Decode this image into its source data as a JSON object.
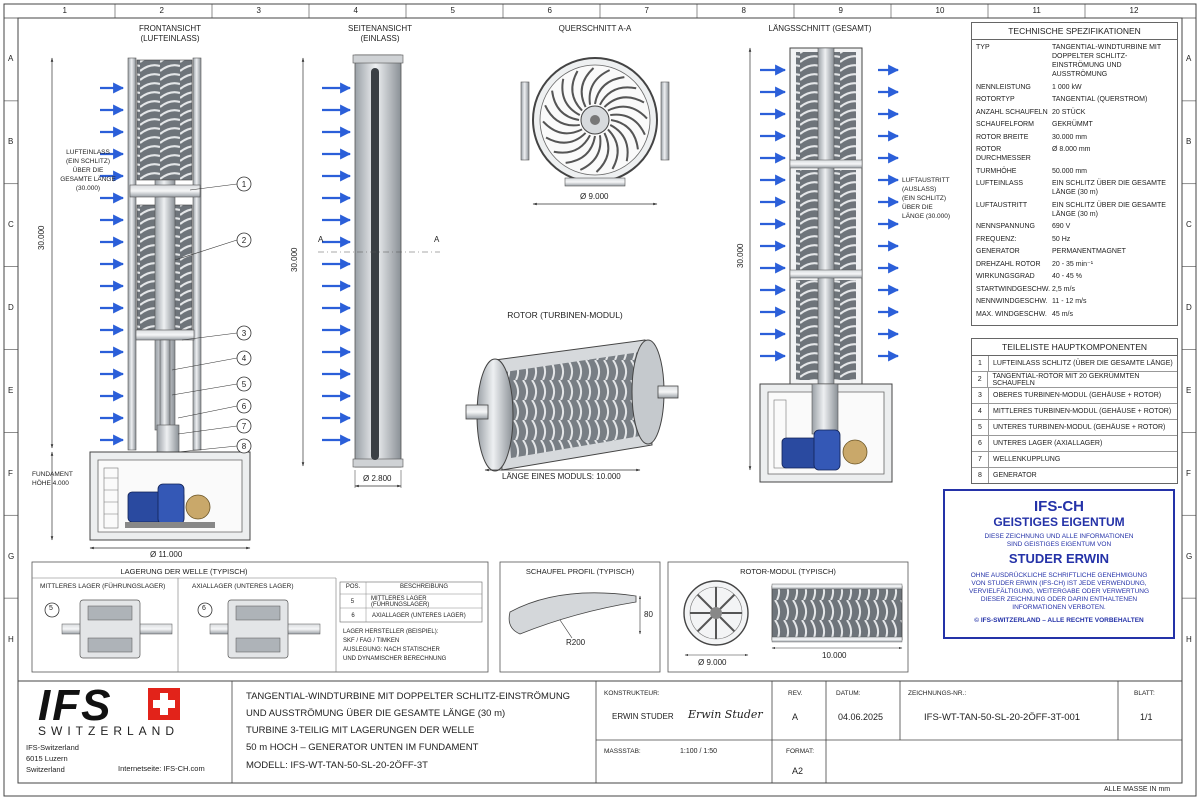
{
  "grid": {
    "cols": [
      "1",
      "2",
      "3",
      "4",
      "5",
      "6",
      "7",
      "8",
      "9",
      "10",
      "11",
      "12"
    ],
    "rows": [
      "A",
      "B",
      "C",
      "D",
      "E",
      "F",
      "G",
      "H"
    ]
  },
  "views": {
    "front_title": "FRONTANSICHT",
    "front_sub": "(LUFTEINLASS)",
    "side_title": "SEITENANSICHT",
    "side_sub": "(EINLASS)",
    "cross_title": "QUERSCHNITT A-A",
    "long_title": "LÄNGSSCHNITT (GESAMT)",
    "rotor_title": "ROTOR (TURBINEN-MODUL)"
  },
  "front": {
    "inlet_note": [
      "LUFTEINLASS",
      "(EIN SCHLITZ)",
      "ÜBER DIE",
      "GESAMTE LÄNGE",
      "(30.000)"
    ],
    "height_dim": "30.000",
    "foundation_note": [
      "FUNDAMENT",
      "HÖHE 4.000"
    ],
    "base_dim": "Ø 11.000",
    "balloons": [
      "1",
      "2",
      "3",
      "4",
      "5",
      "6",
      "7",
      "8"
    ]
  },
  "side": {
    "height_dim": "30.000",
    "section_mark": "A",
    "dia_dim": "Ø 2.800"
  },
  "cross": {
    "dia_dim": "Ø 9.000"
  },
  "longitudinal": {
    "height_dim": "30.000",
    "outlet_note": [
      "LUFTAUSTRITT",
      "(AUSLASS)",
      "(EIN SCHLITZ)",
      "ÜBER DIE",
      "LÄNGE (30.000)"
    ]
  },
  "rotor": {
    "length_dim": "LÄNGE EINES MODULS: 10.000"
  },
  "specs": {
    "title": "TECHNISCHE SPEZIFIKATIONEN",
    "rows": [
      {
        "k": "TYP",
        "v": "TANGENTIAL-WINDTURBINE MIT DOPPELTER SCHLITZ-EINSTRÖMUNG UND AUSSTRÖMUNG"
      },
      {
        "k": "NENNLEISTUNG",
        "v": "1 000 kW"
      },
      {
        "k": "ROTORTYP",
        "v": "TANGENTIAL (QUERSTROM)"
      },
      {
        "k": "ANZAHL SCHAUFELN",
        "v": "20 STÜCK"
      },
      {
        "k": "SCHAUFELFORM",
        "v": "GEKRÜMMT"
      },
      {
        "k": "ROTOR BREITE",
        "v": "30.000 mm"
      },
      {
        "k": "ROTOR DURCHMESSER",
        "v": "Ø 8.000 mm"
      },
      {
        "k": "TURMHÖHE",
        "v": "50.000 mm"
      },
      {
        "k": "LUFTEINLASS",
        "v": "EIN SCHLITZ ÜBER DIE GESAMTE LÄNGE (30 m)"
      },
      {
        "k": "LUFTAUSTRITT",
        "v": "EIN SCHLITZ ÜBER DIE GESAMTE LÄNGE (30 m)"
      },
      {
        "k": "NENNSPANNUNG",
        "v": "690 V"
      },
      {
        "k": "FREQUENZ:",
        "v": "50 Hz"
      },
      {
        "k": "GENERATOR",
        "v": "PERMANENTMAGNET"
      },
      {
        "k": "DREHZAHL ROTOR",
        "v": "20 - 35 min⁻¹"
      },
      {
        "k": "WIRKUNGSGRAD",
        "v": "40 - 45 %"
      },
      {
        "k": "STARTWINDGESCHW.",
        "v": "2,5 m/s"
      },
      {
        "k": "NENNWINDGESCHW.",
        "v": "11 - 12 m/s"
      },
      {
        "k": "MAX. WINDGESCHW.",
        "v": "45 m/s"
      }
    ]
  },
  "parts": {
    "title": "TEILELISTE HAUPTKOMPONENTEN",
    "rows": [
      {
        "n": "1",
        "d": "LUFTEINLASS SCHLITZ (ÜBER DIE GESAMTE LÄNGE)"
      },
      {
        "n": "2",
        "d": "TANGENTIAL-ROTOR MIT 20 GEKRÜMMTEN SCHAUFELN"
      },
      {
        "n": "3",
        "d": "OBERES TURBINEN-MODUL (GEHÄUSE + ROTOR)"
      },
      {
        "n": "4",
        "d": "MITTLERES TURBINEN-MODUL (GEHÄUSE + ROTOR)"
      },
      {
        "n": "5",
        "d": "UNTERES TURBINEN-MODUL (GEHÄUSE + ROTOR)"
      },
      {
        "n": "6",
        "d": "UNTERES LAGER (AXIALLAGER)"
      },
      {
        "n": "7",
        "d": "WELLENKUPPLUNG"
      },
      {
        "n": "8",
        "d": "GENERATOR"
      }
    ]
  },
  "ip": {
    "l1": "IFS-CH",
    "l2": "GEISTIGES EIGENTUM",
    "l3a": "DIESE ZEICHNUNG UND ALLE INFORMATIONEN",
    "l3b": "SIND GEISTIGES EIGENTUM VON",
    "l4": "STUDER ERWIN",
    "l5a": "OHNE AUSDRÜCKLICHE SCHRIFTLICHE GENEHMIGUNG",
    "l5b": "VON STUDER ERWIN (IFS-CH) IST JEDE VERWENDUNG,",
    "l5c": "VERVIELFÄLTIGUNG, WEITERGABE ODER VERWERTUNG",
    "l5d": "DIESER ZEICHNUNG ODER DARIN ENTHALTENEN",
    "l5e": "INFORMATIONEN VERBOTEN.",
    "l6": "© IFS-SWITZERLAND – ALLE RECHTE VORBEHALTEN"
  },
  "bearing": {
    "title": "LAGERUNG DER WELLE (TYPISCH)",
    "mid": "MITTLERES LAGER (FÜHRUNGSLAGER)",
    "axial": "AXIALLAGER (UNTERES LAGER)",
    "b5": "5",
    "b6": "6",
    "table_head": [
      "POS.",
      "BESCHREIBUNG"
    ],
    "table_rows": [
      {
        "n": "5",
        "d": "MITTLERES LAGER (FÜHRUNGSLAGER)"
      },
      {
        "n": "6",
        "d": "AXIALLAGER (UNTERES LAGER)"
      }
    ],
    "notes": [
      "LAGER HERSTELLER (BEISPIEL):",
      "SKF / FAG / TIMKEN",
      "AUSLEGUNG: NACH STATISCHER",
      "UND DYNAMISCHER BERECHNUNG"
    ]
  },
  "blade": {
    "title": "SCHAUFEL PROFIL (TYPISCH)",
    "h": "80",
    "r": "R200"
  },
  "module": {
    "title": "ROTOR-MODUL (TYPISCH)",
    "dia": "Ø 9.000",
    "len": "10.000"
  },
  "titleblock": {
    "logo": "IFS",
    "logo_sub": "SWITZERLAND",
    "addr": [
      "IFS-Switzerland",
      "6015 Luzern",
      "Switzerland"
    ],
    "web": "Internetseite: IFS-CH.com",
    "desc": [
      "TANGENTIAL-WINDTURBINE MIT DOPPELTER SCHLITZ-EINSTRÖMUNG",
      "UND AUSSTRÖMUNG ÜBER DIE GESAMTE LÄNGE (30 m)",
      "TURBINE 3-TEILIG MIT LAGERUNGEN DER WELLE",
      "50 m HOCH – GENERATOR UNTEN IM FUNDAMENT"
    ],
    "model": "MODELL: IFS-WT-TAN-50-SL-20-2ÖFF-3T",
    "designer_lbl": "KONSTRUKTEUR:",
    "designer": "ERWIN STUDER",
    "signature": "Erwin Studer",
    "rev_lbl": "REV.",
    "rev": "A",
    "date_lbl": "DATUM:",
    "date": "04.06.2025",
    "dwg_lbl": "ZEICHNUNGS-NR.:",
    "dwg": "IFS-WT-TAN-50-SL-20-2ÖFF-3T-001",
    "sheet_lbl": "BLATT:",
    "sheet": "1/1",
    "scale_lbl": "MASSSTAB:",
    "scale": "1:100 / 1:50",
    "format_lbl": "FORMAT:",
    "format": "A2",
    "note": "ALLE MASSE IN mm"
  },
  "colors": {
    "arrow": "#2b5fd9",
    "ip": "#2432a8",
    "motor": "#2a4aa0",
    "red": "#e2231a"
  }
}
